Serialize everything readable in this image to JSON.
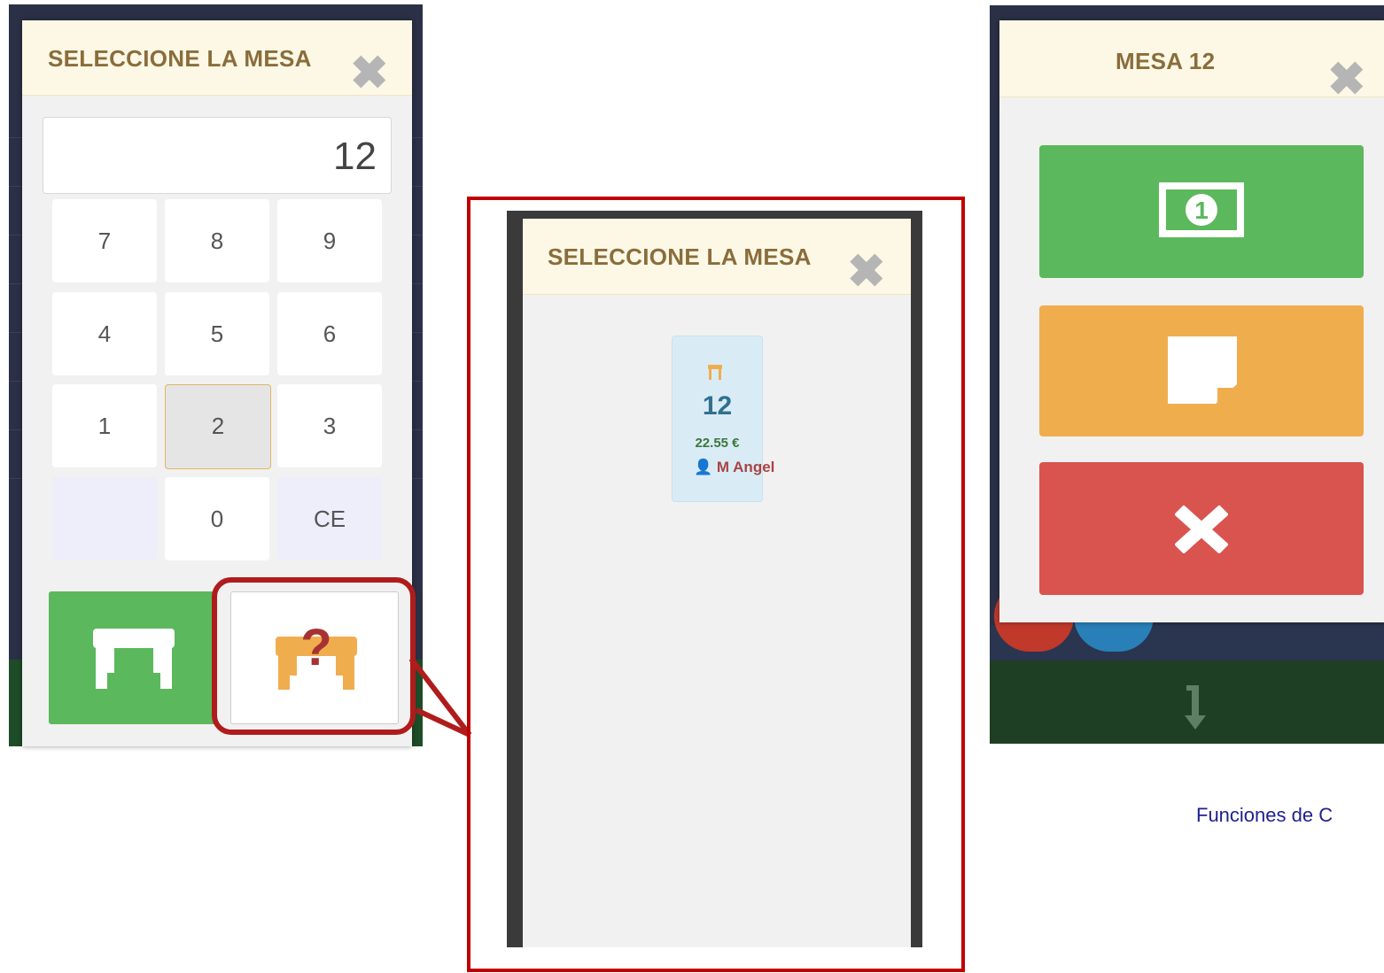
{
  "left_panel": {
    "title": "SELECCIONE LA MESA",
    "close_glyph": "✖",
    "display_value": "12",
    "keypad": [
      {
        "label": "7",
        "name": "key-7"
      },
      {
        "label": "8",
        "name": "key-8"
      },
      {
        "label": "9",
        "name": "key-9"
      },
      {
        "label": "4",
        "name": "key-4"
      },
      {
        "label": "5",
        "name": "key-5"
      },
      {
        "label": "6",
        "name": "key-6"
      },
      {
        "label": "1",
        "name": "key-1"
      },
      {
        "label": "2",
        "name": "key-2"
      },
      {
        "label": "3",
        "name": "key-3"
      },
      {
        "label": "",
        "name": "key-blank"
      },
      {
        "label": "0",
        "name": "key-0"
      },
      {
        "label": "CE",
        "name": "key-ce"
      }
    ],
    "pressed_key": "2",
    "buttons": [
      {
        "name": "select-table-button",
        "icon": "table-icon",
        "color": "#5cb85c"
      },
      {
        "name": "find-table-button",
        "icon": "table-question-icon",
        "color": "#f0ad4e"
      }
    ]
  },
  "middle_panel": {
    "title": "SELECCIONE LA MESA",
    "close_glyph": "✖",
    "table_card": {
      "number": "12",
      "amount": "22.55 €",
      "waiter": "M Angel",
      "icon": "chair-icon"
    }
  },
  "right_panel": {
    "title": "MESA 12",
    "close_glyph": "✖",
    "actions": [
      {
        "name": "pay-button",
        "icon": "banknote-icon",
        "color": "#5cb85c"
      },
      {
        "name": "note-button",
        "icon": "note-icon",
        "color": "#f0ad4e"
      },
      {
        "name": "delete-button",
        "icon": "close-icon",
        "color": "#d9534f"
      }
    ],
    "footer_icon": "arrow-down-icon"
  },
  "caption": "Funciones de C",
  "colors": {
    "header_bg": "#fcf8e5",
    "title_text": "#8a6d3b",
    "highlight_red": "#c00000",
    "caption_text": "#1f1f8f"
  }
}
